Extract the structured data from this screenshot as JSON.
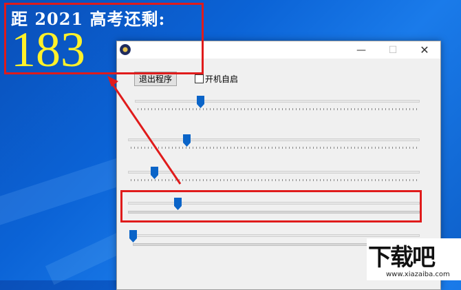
{
  "countdown": {
    "label": "距 2021 高考还剩:",
    "days": "183"
  },
  "window": {
    "icon": "app-clock-icon",
    "minimize": "—",
    "maximize": "☐",
    "close": "✕",
    "exit_button": "退出程序",
    "autostart_label": "开机自启",
    "autostart_checked": false,
    "sliders": [
      {
        "name": "slider-1",
        "value": 0.23
      },
      {
        "name": "slider-2",
        "value": 0.2
      },
      {
        "name": "slider-3",
        "value": 0.09
      },
      {
        "name": "slider-4",
        "value": 0.17
      },
      {
        "name": "slider-5",
        "value": 0.0
      }
    ]
  },
  "annotation": {
    "color": "#e01b1b"
  },
  "watermark": {
    "text": "下载吧",
    "url": "www.xiazaiba.com"
  },
  "colors": {
    "days": "#fff12a",
    "thumb": "#0a64c8",
    "desktop": "#0b63d6"
  }
}
